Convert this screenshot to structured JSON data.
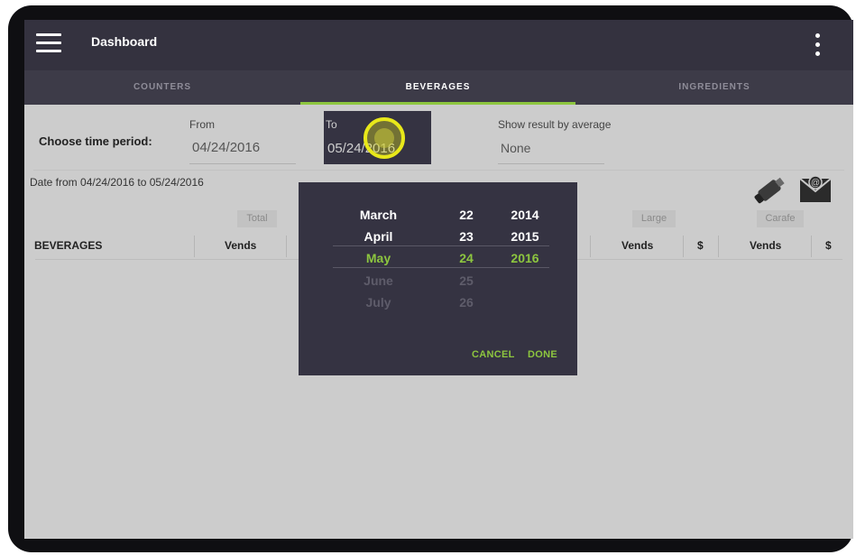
{
  "app_bar": {
    "title": "Dashboard"
  },
  "tabs": [
    {
      "label": "COUNTERS"
    },
    {
      "label": "BEVERAGES"
    },
    {
      "label": "INGREDIENTS"
    }
  ],
  "filters": {
    "choose_label": "Choose time period:",
    "from": {
      "label": "From",
      "value": "04/24/2016"
    },
    "to": {
      "label": "To",
      "value": "05/24/2016"
    },
    "average": {
      "label": "Show result by average",
      "value": "None"
    }
  },
  "date_range_text": "Date from 04/24/2016 to 05/24/2016",
  "toolbar": {
    "usb_icon": "usb-drive-icon",
    "email_icon": "email-envelope-icon"
  },
  "table": {
    "groups": [
      "Total",
      "Large",
      "Carafe"
    ],
    "headers": [
      "BEVERAGES",
      "Vends",
      "Vends",
      "$",
      "Vends",
      "$"
    ]
  },
  "date_picker": {
    "months": [
      "March",
      "April",
      "May",
      "June",
      "July"
    ],
    "days": [
      "22",
      "23",
      "24",
      "25",
      "26"
    ],
    "years": [
      "2014",
      "2015",
      "2016"
    ],
    "selected": {
      "month": "May",
      "day": "24",
      "year": "2016"
    },
    "cancel_label": "CANCEL",
    "done_label": "DONE"
  },
  "colors": {
    "accent": "#8dc63f",
    "appbar": "#34323f",
    "tabbar": "#3d3b48",
    "picker_bg": "#353342",
    "highlight": "#e8e81a"
  }
}
